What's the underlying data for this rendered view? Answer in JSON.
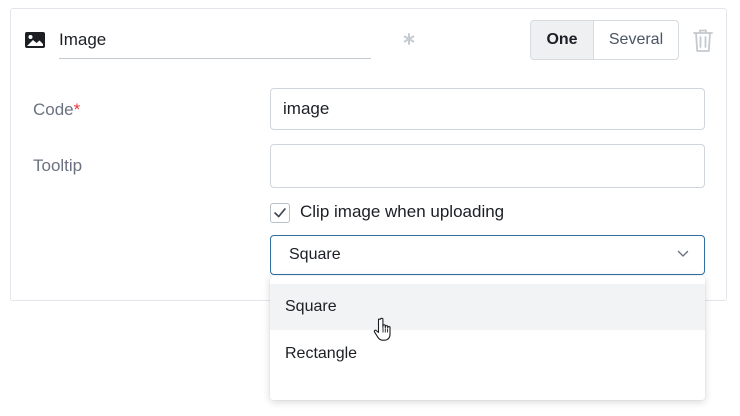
{
  "header": {
    "icon": "image-icon",
    "title": "Image",
    "required_icon": "asterisk-icon",
    "segmented": {
      "options": [
        "One",
        "Several"
      ],
      "selected": "One"
    },
    "delete_icon": "trash-icon"
  },
  "form": {
    "code": {
      "label": "Code",
      "required_mark": "*",
      "value": "image"
    },
    "tooltip": {
      "label": "Tooltip",
      "value": ""
    },
    "clip": {
      "label": "Clip image when uploading",
      "checked": true
    },
    "shape_select": {
      "value": "Square",
      "icon": "chevron-down-icon"
    }
  },
  "dropdown": {
    "options": [
      "Square",
      "Rectangle"
    ],
    "hovered": "Square"
  },
  "colors": {
    "accent_border": "#2f6fa3",
    "required": "#e53935",
    "hover_bg": "#f2f3f4"
  }
}
